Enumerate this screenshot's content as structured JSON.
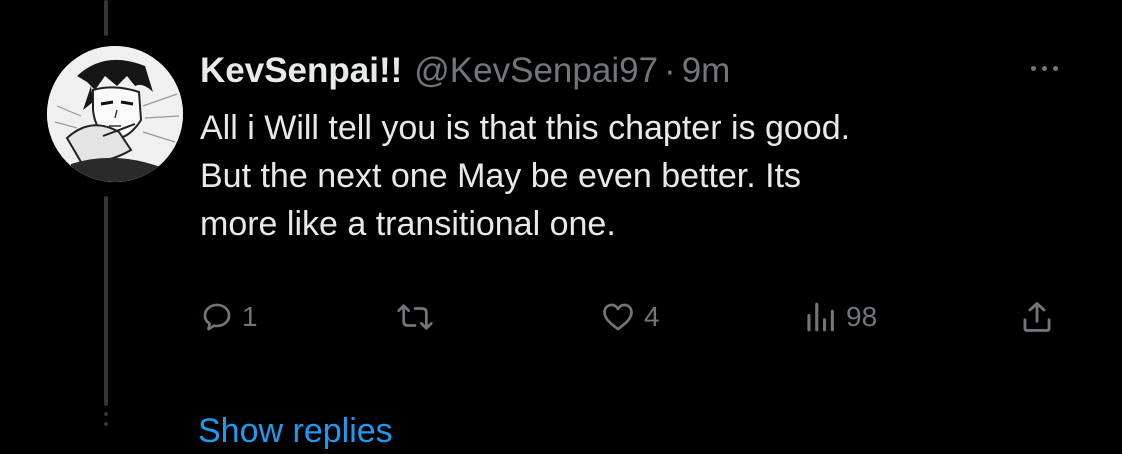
{
  "tweet": {
    "display_name": "KevSenpai!!",
    "handle": "@KevSenpai97",
    "separator": "·",
    "timestamp": "9m",
    "text_lines": [
      "All i Will tell you is that this chapter is good.",
      "But the next one May be even better. Its",
      "more like a transitional one."
    ],
    "actions": {
      "reply": {
        "icon": "reply-icon",
        "count": "1"
      },
      "retweet": {
        "icon": "retweet-icon",
        "count": ""
      },
      "like": {
        "icon": "heart-icon",
        "count": "4"
      },
      "views": {
        "icon": "views-icon",
        "count": "98"
      },
      "share": {
        "icon": "share-icon"
      }
    }
  },
  "thread": {
    "show_replies_label": "Show replies"
  },
  "colors": {
    "background": "#000000",
    "primary_text": "#e7e9ea",
    "secondary_text": "#71767b",
    "link": "#1d9bf0",
    "thread_line": "#333639"
  }
}
